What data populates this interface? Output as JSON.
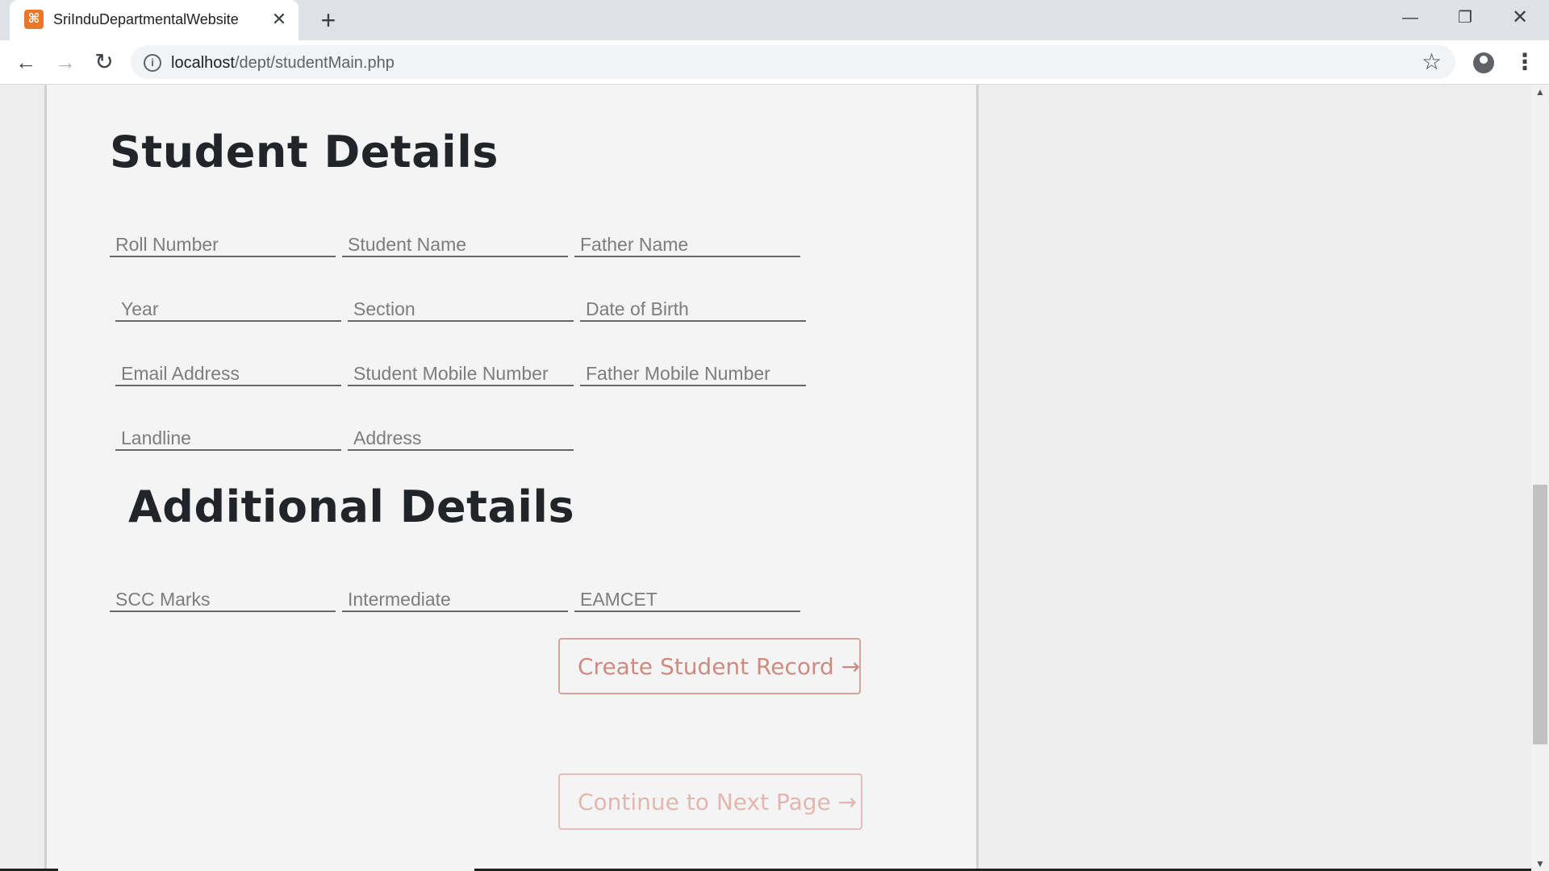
{
  "browser": {
    "tab_title": "SriInduDepartmentalWebsite",
    "favicon_glyph": "⌘",
    "close_glyph": "✕",
    "new_tab_glyph": "+",
    "url_host": "localhost",
    "url_path": "/dept/studentMain.php",
    "window_min": "—",
    "window_restore": "❐",
    "window_close": "✕",
    "back_glyph": "←",
    "forward_glyph": "→",
    "reload_glyph": "↻",
    "info_glyph": "i",
    "star_glyph": "☆",
    "menu_glyph": "⋮",
    "icons": [
      "favicon-icon",
      "close-icon",
      "plus-icon",
      "back-arrow-icon",
      "forward-arrow-icon",
      "reload-icon",
      "info-icon",
      "star-icon",
      "profile-icon",
      "kebab-menu-icon"
    ]
  },
  "page": {
    "student_heading": "Student Details",
    "additional_heading": "Additional Details",
    "student_fields": {
      "roll_number": "Roll Number",
      "student_name": "Student Name",
      "father_name": "Father Name",
      "year": "Year",
      "section": "Section",
      "dob": "Date of Birth",
      "email": "Email Address",
      "student_mobile": "Student Mobile Number",
      "father_mobile": "Father Mobile Number",
      "landline": "Landline",
      "address": "Address"
    },
    "additional_fields": {
      "ssc_marks": "SCC Marks",
      "intermediate": "Intermediate",
      "eamcet": "EAMCET"
    },
    "create_button": "Create Student Record →",
    "continue_button": "Continue to Next Page →",
    "colors": {
      "accent": "#cd8c80",
      "heading": "#212529"
    }
  },
  "scrollbar": {
    "up_glyph": "▲",
    "down_glyph": "▼",
    "scroll_position": 0.7
  }
}
